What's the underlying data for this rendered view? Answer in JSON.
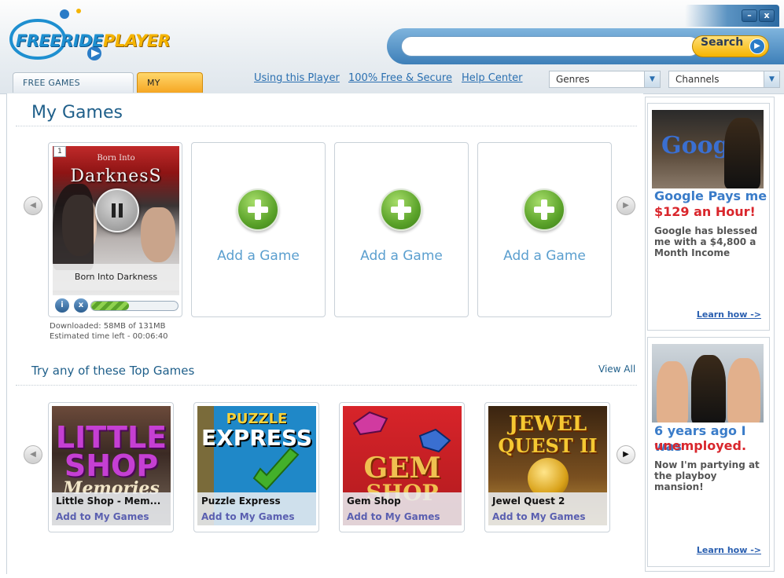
{
  "app": {
    "logo_free": "FREERIDE",
    "logo_player": "PLAYER"
  },
  "window": {
    "minimize_symbol": "–",
    "close_symbol": "x"
  },
  "search": {
    "placeholder": "",
    "button_label": "Search"
  },
  "tabs": [
    {
      "label": "FREE GAMES CATALOG",
      "active": false
    },
    {
      "label": "MY GAMES",
      "active": true
    }
  ],
  "nav": {
    "using": "Using this Player",
    "free_secure": "100% Free & Secure",
    "help": "Help Center"
  },
  "filters": {
    "genres": "Genres",
    "channels": "Channels"
  },
  "my_games": {
    "title": "My Games",
    "current": {
      "slot_number": "1",
      "cover_title": "DarknesS",
      "cover_subtitle": "Born Into",
      "name": "Born Into Darkness",
      "progress_fraction": 0.44,
      "downloaded": "Downloaded: 58MB of 131MB",
      "time_left": "Estimated time left - 00:06:40"
    },
    "add_label": "Add a Game"
  },
  "top_games": {
    "title": "Try any of these Top Games",
    "view_all": "View All",
    "add_label": "Add to My Games",
    "games": [
      {
        "name": "Little Shop - Mem...",
        "art_text_1": "LITTLE",
        "art_text_2": "SHOP",
        "art_text_3": "Memories"
      },
      {
        "name": "Puzzle Express",
        "art_text_1": "PUZZLE",
        "art_text_2": "EXPRESS"
      },
      {
        "name": "Gem Shop",
        "art_text_1": "GEM",
        "art_text_2": "SHOP"
      },
      {
        "name": "Jewel Quest 2",
        "art_text_1": "JEWEL",
        "art_text_2": "QUEST II"
      }
    ]
  },
  "ads": [
    {
      "image_text": "Google",
      "head_1": "Google Pays me",
      "head_2": "$129 an Hour",
      "head_2_suffix": "!",
      "body": "Google has blessed me with a $4,800 a Month Income",
      "learn": "Learn how ->"
    },
    {
      "head_1": "6 years ago I was",
      "head_2": "unemployed.",
      "body": "Now I'm partying at the playboy mansion!",
      "learn": "Learn how ->"
    }
  ],
  "colors": {
    "accent_blue": "#1f5f8a",
    "link_blue": "#2a6fb0",
    "tab_active": "#f5a623",
    "ad_red": "#d9262c"
  }
}
